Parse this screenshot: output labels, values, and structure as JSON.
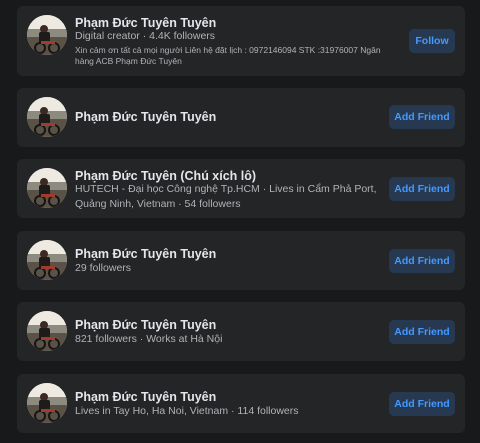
{
  "results": [
    {
      "name": "Phạm Đức Tuyên Tuyên",
      "line1": "Digital creator · 4.4K followers",
      "line2": "Xin cảm ơn tất cả mọi người Liên hệ đặt lịch : 0972146094 STK :31976007 Ngân hàng ACB Phạm Đức Tuyên",
      "button": "Follow"
    },
    {
      "name": "Phạm Đức Tuyên Tuyên",
      "button": "Add Friend"
    },
    {
      "name": "Phạm Đức Tuyên (Chú xích lô)",
      "line1": "HUTECH - Đại học Công nghệ Tp.HCM · Lives in Cẩm Phả Port, Quảng Ninh, Vietnam · 54 followers",
      "button": "Add Friend"
    },
    {
      "name": "Phạm Đức Tuyên Tuyên",
      "line1": "29 followers",
      "button": "Add Friend"
    },
    {
      "name": "Phạm Đức Tuyên Tuyên",
      "line1": "821 followers · Works at Hà Nội",
      "button": "Add Friend"
    },
    {
      "name": "Phạm Đức Tuyên Tuyên",
      "line1": "Lives in Tay Ho, Ha Noi, Vietnam · 114 followers",
      "button": "Add Friend"
    }
  ]
}
